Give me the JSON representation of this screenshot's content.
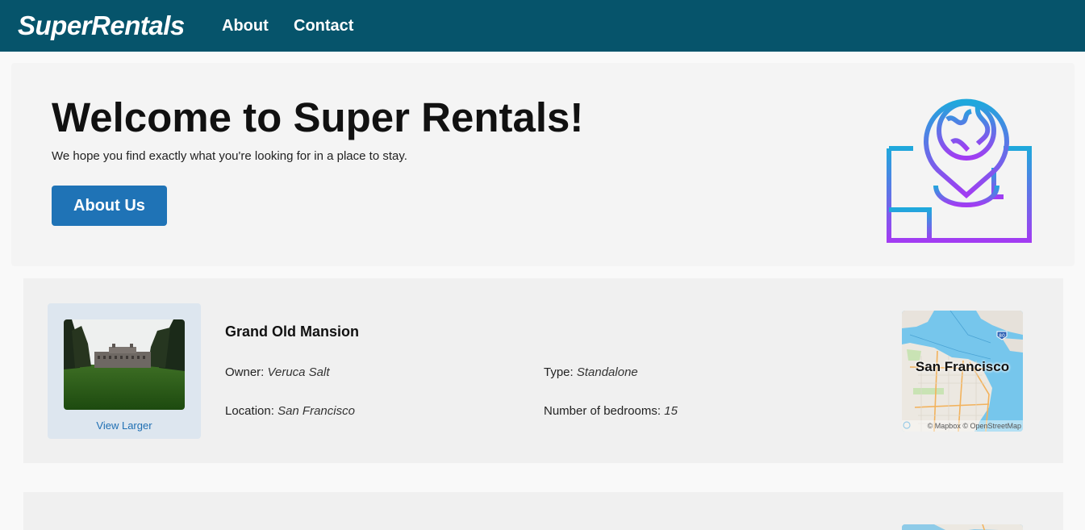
{
  "nav": {
    "brand": "SuperRentals",
    "links": [
      "About",
      "Contact"
    ]
  },
  "jumbo": {
    "title": "Welcome to Super Rentals!",
    "subtitle": "We hope you find exactly what you're looking for in a place to stay.",
    "button": "About Us",
    "illustration": "map-pin-globe-icon"
  },
  "rentals": [
    {
      "title": "Grand Old Mansion",
      "image_link": "View Larger",
      "owner_label": "Owner:",
      "owner": "Veruca Salt",
      "type_label": "Type:",
      "type": "Standalone",
      "location_label": "Location:",
      "location": "San Francisco",
      "bedrooms_label": "Number of bedrooms:",
      "bedrooms": "15",
      "map": {
        "label": "San Francisco",
        "attribution": "© Mapbox © OpenStreetMap",
        "shield": "80"
      }
    }
  ],
  "colors": {
    "navbar": "#06546b",
    "button": "#1f73b6",
    "link": "#1f6fb3",
    "gradient_top": "#1fa8dc",
    "gradient_bottom": "#a23cf2"
  }
}
